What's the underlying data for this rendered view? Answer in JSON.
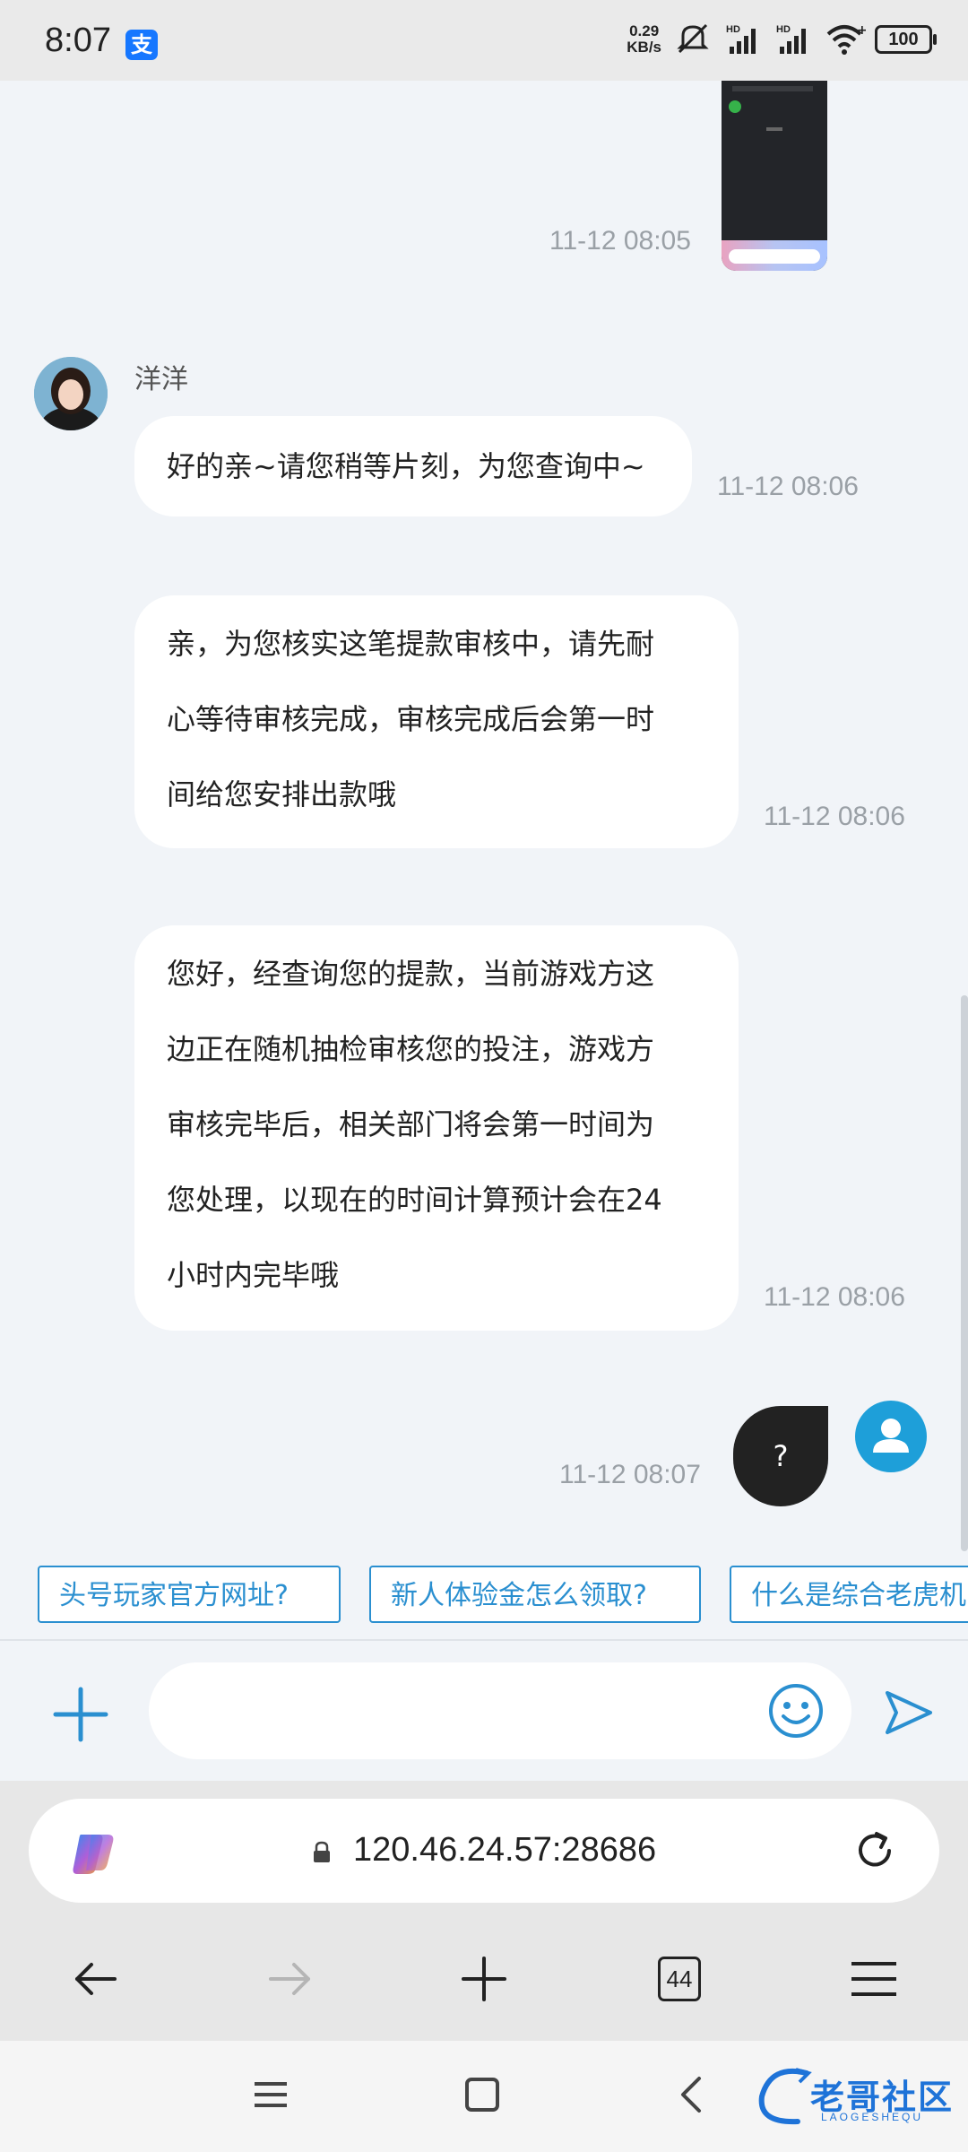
{
  "status_bar": {
    "time": "8:07",
    "app_badge": "支",
    "net_speed_value": "0.29",
    "net_speed_unit": "KB/s",
    "signal1_label": "HD",
    "signal2_label": "HD",
    "battery": "100",
    "icons": [
      "mute-icon",
      "signal-icon",
      "signal-icon",
      "wifi-icon",
      "battery-icon"
    ]
  },
  "chat": {
    "messages": [
      {
        "from": "user",
        "type": "image",
        "time": "11-12 08:05"
      },
      {
        "from": "agent",
        "name": "洋洋",
        "lines": [
          "好的亲~请您稍等片刻，为您查询中~"
        ],
        "time": "11-12 08:06"
      },
      {
        "from": "agent",
        "lines": [
          "亲，为您核实这笔提款审核中，请先耐",
          "心等待审核完成，审核完成后会第一时",
          "间给您安排出款哦"
        ],
        "time": "11-12 08:06"
      },
      {
        "from": "agent",
        "lines": [
          "您好，经查询您的提款，当前游戏方这",
          "边正在随机抽检审核您的投注，游戏方",
          "审核完毕后，相关部门将会第一时间为",
          "您处理，以现在的时间计算预计会在24",
          "小时内完毕哦"
        ],
        "time": "11-12 08:06"
      },
      {
        "from": "user",
        "type": "text",
        "text": "?",
        "time": "11-12 08:07"
      }
    ]
  },
  "quick_questions": [
    "头号玩家官方网址?",
    "新人体验金怎么领取?",
    "什么是综合老虎机"
  ],
  "composer": {
    "placeholder": "",
    "value": ""
  },
  "browser": {
    "url": "120.46.24.57:28686",
    "tab_count": "44"
  },
  "watermark": {
    "text": "老哥社区",
    "sub": "LAOGESHEQU"
  },
  "colors": {
    "accent": "#2a8fd0",
    "background": "#f1f4f8",
    "user_bubble": "#222222",
    "agent_bubble": "#ffffff"
  }
}
